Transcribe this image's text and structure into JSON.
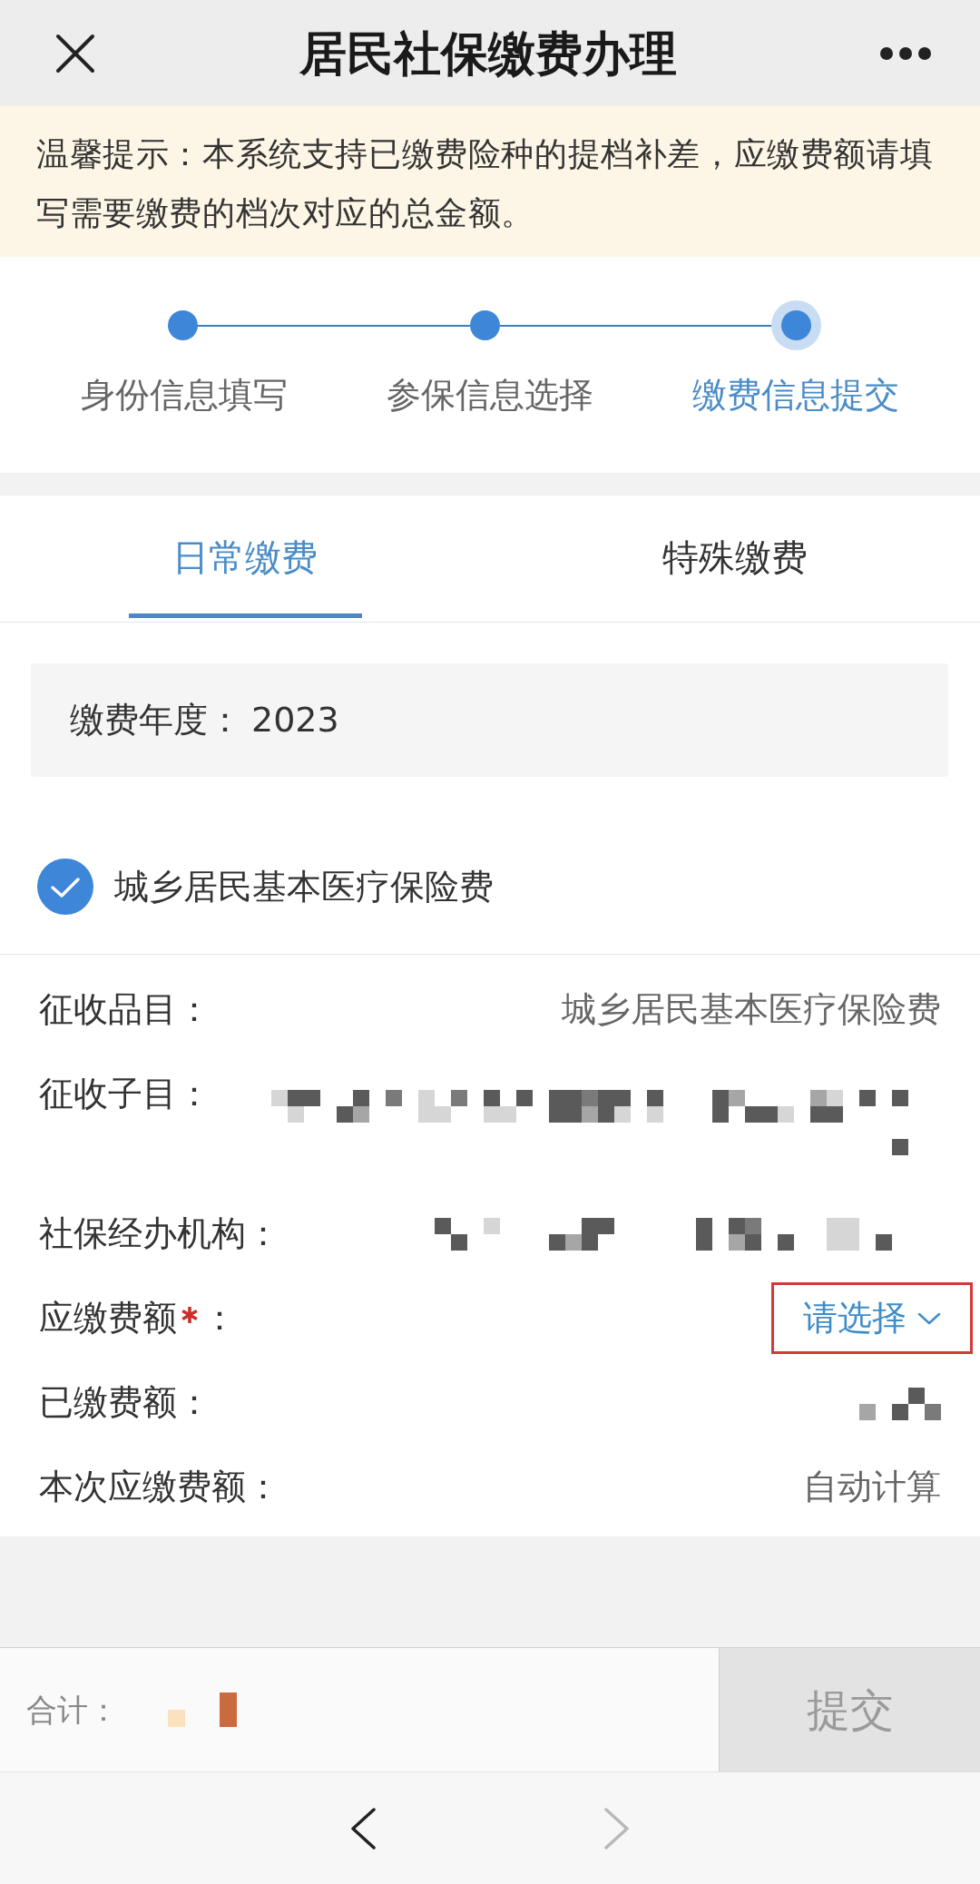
{
  "header": {
    "title": "居民社保缴费办理"
  },
  "notice": {
    "text": "温馨提示：本系统支持已缴费险种的提档补差，应缴费额请填写需要缴费的档次对应的总金额。"
  },
  "steps": [
    {
      "label": "身份信息填写",
      "done": true,
      "current": false
    },
    {
      "label": "参保信息选择",
      "done": true,
      "current": false
    },
    {
      "label": "缴费信息提交",
      "done": false,
      "current": true
    }
  ],
  "tabs": [
    {
      "label": "日常缴费",
      "selected": true
    },
    {
      "label": "特殊缴费",
      "selected": false
    }
  ],
  "year": {
    "label": "缴费年度：",
    "value": "2023"
  },
  "insurance": {
    "label": "城乡居民基本医疗保险费",
    "checked": true
  },
  "fields": [
    {
      "kind": "text",
      "label": "征收品目：",
      "required": false,
      "highlighted": false,
      "value": "城乡居民基本医疗保险费"
    },
    {
      "kind": "redacted",
      "label": "征收子目：",
      "required": false,
      "highlighted": false
    },
    {
      "kind": "redacted",
      "label": "社保经办机构：",
      "required": false,
      "highlighted": false
    },
    {
      "kind": "select",
      "label": "应缴费额",
      "required": true,
      "label_end": "：",
      "highlighted": true,
      "placeholder": "请选择"
    },
    {
      "kind": "redacted",
      "label": "已缴费额：",
      "required": false,
      "highlighted": false
    },
    {
      "kind": "text",
      "label": "本次应缴费额：",
      "required": false,
      "highlighted": false,
      "value": "自动计算"
    }
  ],
  "footer": {
    "total_label": "合计：",
    "total_redacted": true,
    "submit": {
      "label": "提交",
      "disabled": true
    }
  },
  "browser_nav": [
    {
      "kind": "back",
      "disabled": false
    },
    {
      "kind": "forward",
      "disabled": true
    }
  ]
}
